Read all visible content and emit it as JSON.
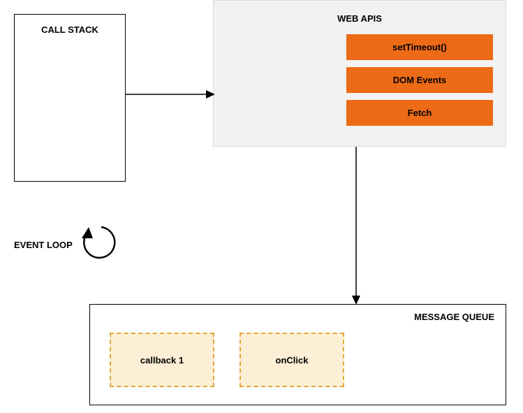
{
  "call_stack": {
    "title": "CALL STACK"
  },
  "web_apis": {
    "title": "WEB APIS",
    "items": [
      {
        "label": "setTimeout()"
      },
      {
        "label": "DOM Events"
      },
      {
        "label": "Fetch"
      }
    ]
  },
  "event_loop": {
    "label": "EVENT LOOP"
  },
  "message_queue": {
    "title": "MESSAGE QUEUE",
    "items": [
      {
        "label": "callback 1"
      },
      {
        "label": "onClick"
      }
    ]
  }
}
